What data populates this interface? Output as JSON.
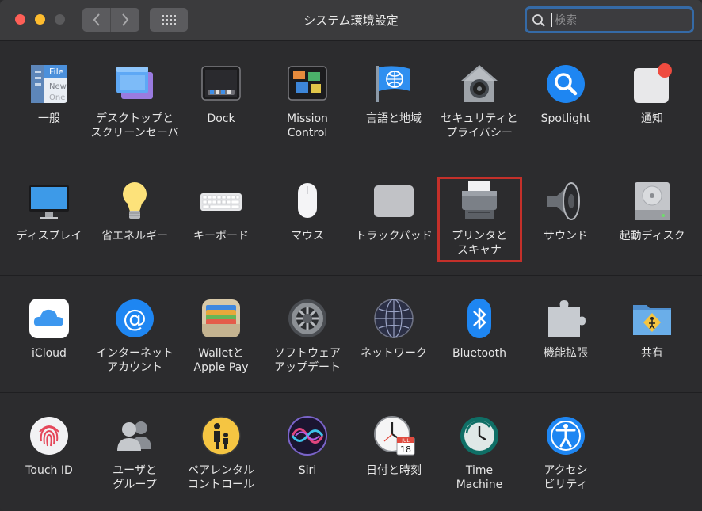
{
  "window": {
    "title": "システム環境設定",
    "search": {
      "placeholder": "検索",
      "value": ""
    }
  },
  "toolbar": {
    "back_icon": "chevron-left-icon",
    "forward_icon": "chevron-right-icon",
    "show_all_icon": "grid-icon"
  },
  "sections": [
    {
      "items": [
        {
          "label": "一般",
          "icon": "general-icon"
        },
        {
          "label": "デスクトップと\nスクリーンセーバ",
          "icon": "desktop-screensaver-icon"
        },
        {
          "label": "Dock",
          "icon": "dock-icon"
        },
        {
          "label": "Mission\nControl",
          "icon": "mission-control-icon"
        },
        {
          "label": "言語と地域",
          "icon": "language-region-icon"
        },
        {
          "label": "セキュリティと\nプライバシー",
          "icon": "security-privacy-icon"
        },
        {
          "label": "Spotlight",
          "icon": "spotlight-icon"
        },
        {
          "label": "通知",
          "icon": "notifications-icon"
        }
      ]
    },
    {
      "items": [
        {
          "label": "ディスプレイ",
          "icon": "displays-icon"
        },
        {
          "label": "省エネルギー",
          "icon": "energy-saver-icon"
        },
        {
          "label": "キーボード",
          "icon": "keyboard-icon"
        },
        {
          "label": "マウス",
          "icon": "mouse-icon"
        },
        {
          "label": "トラックパッド",
          "icon": "trackpad-icon"
        },
        {
          "label": "プリンタと\nスキャナ",
          "icon": "printers-scanners-icon"
        },
        {
          "label": "サウンド",
          "icon": "sound-icon"
        },
        {
          "label": "起動ディスク",
          "icon": "startup-disk-icon"
        }
      ]
    },
    {
      "items": [
        {
          "label": "iCloud",
          "icon": "icloud-icon"
        },
        {
          "label": "インターネット\nアカウント",
          "icon": "internet-accounts-icon"
        },
        {
          "label": "Walletと\nApple Pay",
          "icon": "wallet-applepay-icon"
        },
        {
          "label": "ソフトウェア\nアップデート",
          "icon": "software-update-icon"
        },
        {
          "label": "ネットワーク",
          "icon": "network-icon"
        },
        {
          "label": "Bluetooth",
          "icon": "bluetooth-icon"
        },
        {
          "label": "機能拡張",
          "icon": "extensions-icon"
        },
        {
          "label": "共有",
          "icon": "sharing-icon"
        }
      ]
    },
    {
      "items": [
        {
          "label": "Touch ID",
          "icon": "touch-id-icon"
        },
        {
          "label": "ユーザと\nグループ",
          "icon": "users-groups-icon"
        },
        {
          "label": "ペアレンタル\nコントロール",
          "icon": "parental-controls-icon"
        },
        {
          "label": "Siri",
          "icon": "siri-icon"
        },
        {
          "label": "日付と時刻",
          "icon": "date-time-icon"
        },
        {
          "label": "Time\nMachine",
          "icon": "time-machine-icon"
        },
        {
          "label": "アクセシ\nビリティ",
          "icon": "accessibility-icon"
        }
      ]
    }
  ],
  "icon_text": {
    "general_file": "File",
    "general_new": "New",
    "general_open": "One",
    "calendar_month": "JUL",
    "calendar_day": "18"
  },
  "highlighted_item": "プリンタと\nスキャナ",
  "colors": {
    "highlight": "#c4302a",
    "search_focus": "#356aa6",
    "accent": "#1d82f5"
  }
}
